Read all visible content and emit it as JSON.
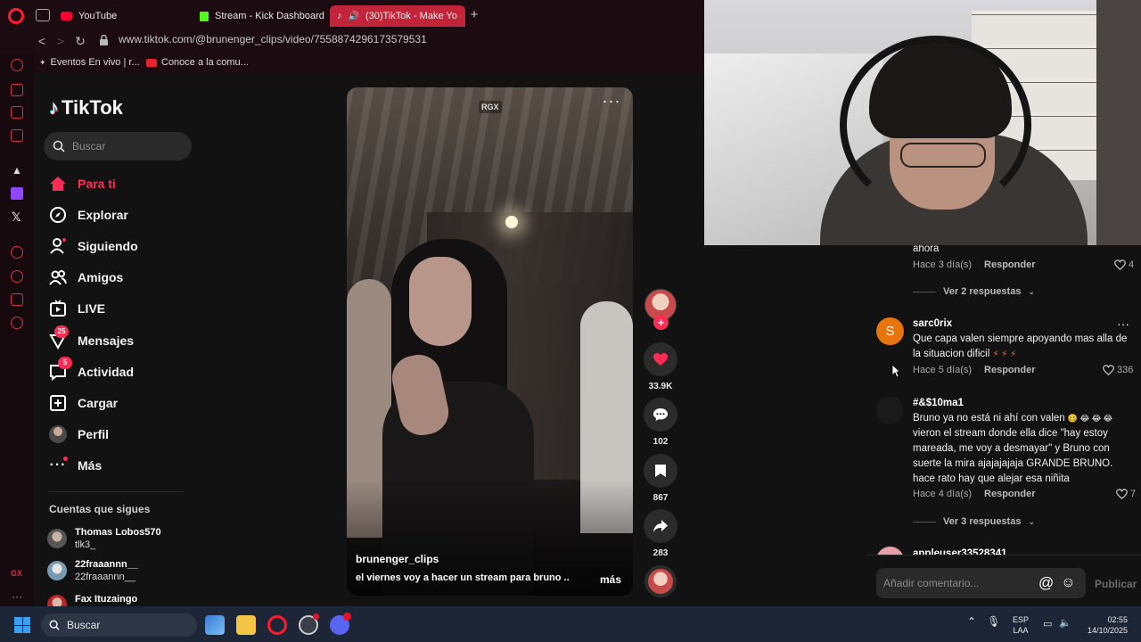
{
  "browser": {
    "tabs": [
      {
        "title": "YouTube",
        "color": "#ff0033"
      },
      {
        "title": "Stream - Kick Dashboard",
        "color": "#53fc18"
      },
      {
        "title": "(30)TikTok - Make Yo",
        "color": "#ffffff"
      }
    ],
    "url": "www.tiktok.com/@brunenger_clips/video/7558874296173579531",
    "bookmarks": [
      "Eventos En vivo | r...",
      "Conoce a la comu..."
    ]
  },
  "tiktok": {
    "logo_text": "TikTok",
    "search_placeholder": "Buscar",
    "nav": [
      {
        "label": "Para ti",
        "icon": "home-icon",
        "active": true
      },
      {
        "label": "Explorar",
        "icon": "compass-icon"
      },
      {
        "label": "Siguiendo",
        "icon": "following-icon"
      },
      {
        "label": "Amigos",
        "icon": "friends-icon"
      },
      {
        "label": "LIVE",
        "icon": "live-icon"
      },
      {
        "label": "Mensajes",
        "icon": "messages-icon",
        "badge": "25"
      },
      {
        "label": "Actividad",
        "icon": "activity-icon",
        "badge": "5"
      },
      {
        "label": "Cargar",
        "icon": "upload-icon"
      },
      {
        "label": "Perfil",
        "icon": "profile-avatar"
      },
      {
        "label": "Más",
        "icon": "more-icon"
      }
    ],
    "following_title": "Cuentas que sigues",
    "following": [
      {
        "name": "Thomas Lobos570",
        "handle": "tlk3_"
      },
      {
        "name": "22fraaannn__",
        "handle": "22fraaannn__"
      },
      {
        "name": "Fax Ituzaingo",
        "handle": ""
      }
    ],
    "video": {
      "watermark": "RGX",
      "username": "brunenger_clips",
      "caption": "el viernes voy a hacer un stream para bruno ...",
      "more": "más",
      "likes": "33.9K",
      "comments": "102",
      "saves": "867",
      "shares": "283"
    },
    "comments": [
      {
        "text_tail": "ahora",
        "time": "Hace 3 día(s)",
        "reply": "Responder",
        "likes": "4",
        "view_replies": "Ver 2 respuestas"
      },
      {
        "user": "sarc0rix",
        "avatar_letter": "S",
        "avatar_color": "#e8740c",
        "text": "Que capa valen siempre apoyando mas alla de la situacion dificil",
        "emoji": "⚡ ⚡ ⚡",
        "time": "Hace 5 día(s)",
        "reply": "Responder",
        "likes": "336"
      },
      {
        "user": "#&$10ma1",
        "text": "Bruno ya no está ni ahí con valen",
        "emoji": "🥴 😂 😂 😂",
        "text2": "vieron el stream donde ella dice \"hay estoy mareada, me voy a desmayar\" y Bruno con suerte la mira ajajajajaja GRANDE BRUNO. hace rato hay que alejar esa niñita",
        "time": "Hace 4 día(s)",
        "reply": "Responder",
        "likes": "7",
        "view_replies": "Ver 3 respuestas"
      },
      {
        "user": "appleuser33528341"
      }
    ],
    "comment_placeholder": "Añadir comentario...",
    "publish": "Publicar"
  },
  "taskbar": {
    "search": "Buscar",
    "lang1": "ESP",
    "lang2": "LAA",
    "time": "02:55",
    "date": "14/10/2025"
  }
}
